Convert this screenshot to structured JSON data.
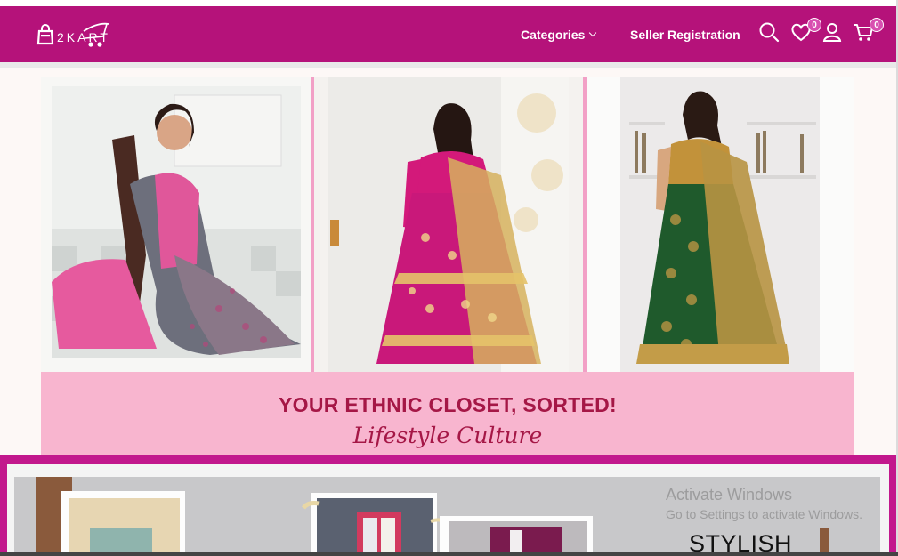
{
  "header": {
    "logo_text": "2KART",
    "nav": {
      "categories_label": "Categories",
      "seller_label": "Seller Registration"
    },
    "icons": [
      "search-icon",
      "heart-icon",
      "user-icon",
      "cart-icon"
    ],
    "wishlist_count": "0",
    "cart_count": "0"
  },
  "hero": {
    "banner_title": "YOUR ETHNIC CLOSET, SORTED!",
    "banner_script": "Lifestyle Culture"
  },
  "promo": {
    "heading": "STYLISH"
  },
  "os_watermark": {
    "title": "Activate Windows",
    "subtitle": "Go to Settings to activate Windows."
  },
  "colors": {
    "brand": "#b5127a",
    "banner_bg": "#f8b5cf",
    "banner_text": "#a51746",
    "badge": "#d84fb0"
  }
}
